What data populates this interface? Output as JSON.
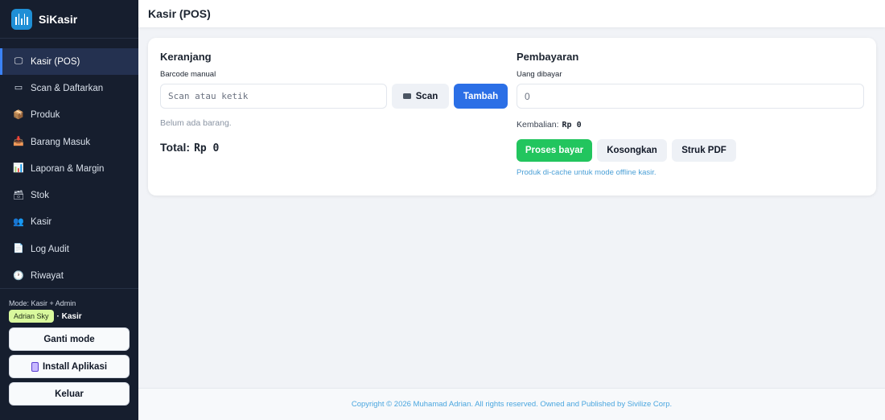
{
  "brand": {
    "name": "SiKasir",
    "logo_icon": "barcode-icon",
    "accent": "#1f8fd6"
  },
  "sidebar": {
    "items": [
      {
        "label": "Kasir (POS)",
        "icon": "register-icon",
        "glyph": "🖵",
        "active": true
      },
      {
        "label": "Scan & Daftarkan",
        "icon": "scanner-icon",
        "glyph": "▭",
        "active": false
      },
      {
        "label": "Produk",
        "icon": "box-icon",
        "glyph": "📦",
        "active": false
      },
      {
        "label": "Barang Masuk",
        "icon": "inbox-icon",
        "glyph": "📥",
        "active": false
      },
      {
        "label": "Laporan & Margin",
        "icon": "chart-icon",
        "glyph": "📊",
        "active": false
      },
      {
        "label": "Stok",
        "icon": "stock-icon",
        "glyph": "🗃",
        "active": false
      },
      {
        "label": "Kasir",
        "icon": "users-icon",
        "glyph": "👥",
        "active": false
      },
      {
        "label": "Log Audit",
        "icon": "document-icon",
        "glyph": "📄",
        "active": false
      },
      {
        "label": "Riwayat",
        "icon": "clock-icon",
        "glyph": "🕐",
        "active": false
      }
    ],
    "mode_text": "Mode: Kasir + Admin",
    "user_name": "Adrian Sky",
    "user_role": "· Kasir",
    "ganti_mode": "Ganti mode",
    "install_label": "Install Aplikasi",
    "install_icon": "phone-icon",
    "keluar": "Keluar"
  },
  "header": {
    "title": "Kasir (POS)"
  },
  "cart": {
    "title": "Keranjang",
    "barcode_label": "Barcode manual",
    "barcode_placeholder": "Scan atau ketik",
    "scan_label": "Scan",
    "scan_icon": "camera-icon",
    "add_label": "Tambah",
    "empty_text": "Belum ada barang.",
    "total_label": "Total:",
    "total_value": "Rp 0"
  },
  "payment": {
    "title": "Pembayaran",
    "paid_label": "Uang dibayar",
    "paid_placeholder": "0",
    "change_label": "Kembalian:",
    "change_value": "Rp 0",
    "process_label": "Proses bayar",
    "clear_label": "Kosongkan",
    "receipt_label": "Struk PDF",
    "cache_note": "Produk di-cache untuk mode offline kasir."
  },
  "footer": {
    "copyright": "Copyright © 2026 Muhamad Adrian. All rights reserved. Owned and Published by Sivilize Corp."
  },
  "colors": {
    "sidebar_bg": "#161e2e",
    "primary_blue": "#2b6fe6",
    "success_green": "#22c55e",
    "link_blue": "#4aa6df"
  }
}
